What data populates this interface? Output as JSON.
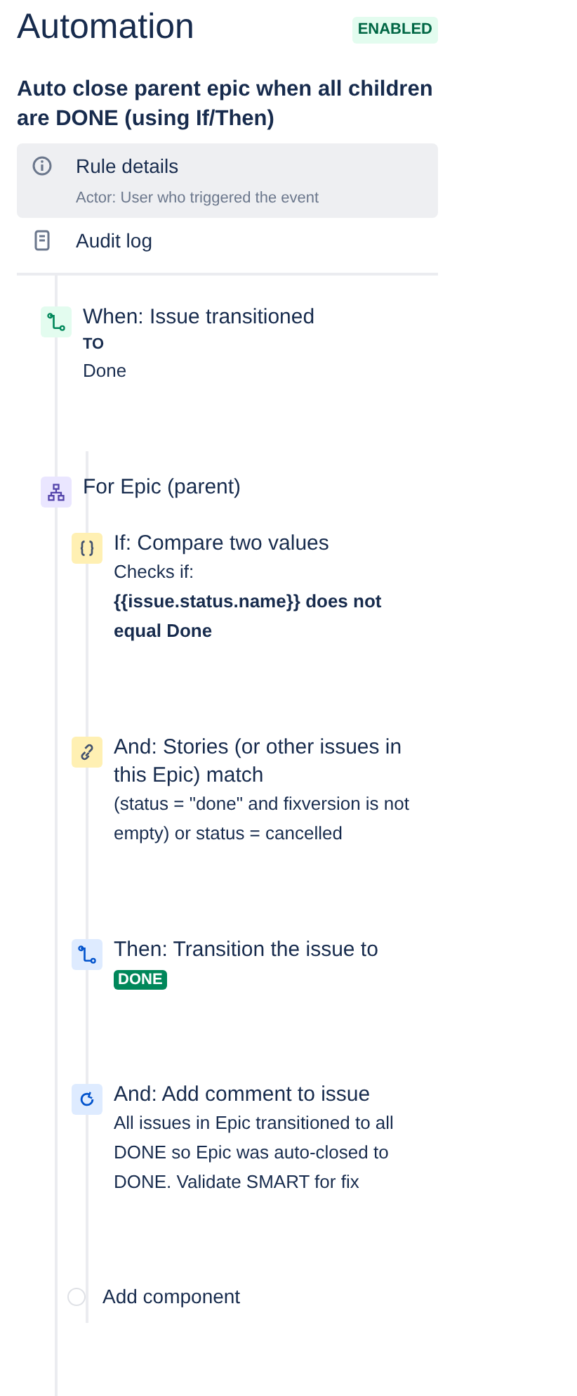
{
  "header": {
    "title": "Automation",
    "status": "ENABLED",
    "enabled": true
  },
  "rule_name": "Auto close parent epic when all children are DONE (using If/Then)",
  "menu": [
    {
      "label": "Rule details",
      "sublabel": "Actor: User who triggered the event",
      "selected": true
    },
    {
      "label": "Audit log",
      "selected": false
    }
  ],
  "flow": [
    {
      "kind": "trigger",
      "title": "When: Issue transitioned",
      "details": [
        {
          "kind": "label",
          "text": "TO"
        },
        {
          "kind": "text",
          "text": "Done"
        }
      ]
    },
    {
      "kind": "branch",
      "title": "For Epic (parent)",
      "children": [
        {
          "kind": "compare",
          "title": "If: Compare two values",
          "details": [
            {
              "kind": "text",
              "text": "Checks if:"
            },
            {
              "kind": "strong",
              "text": "{{issue.status.name}} does not equal Done"
            }
          ]
        },
        {
          "kind": "related",
          "title": "And: Stories (or other issues in this Epic) match",
          "details": [
            {
              "kind": "text",
              "text": "(status = \"done\" and fixversion is not empty) or status = cancelled"
            }
          ]
        },
        {
          "kind": "transition",
          "title": "Then: Transition the issue to",
          "details": [
            {
              "kind": "lozenge",
              "text": "DONE"
            }
          ]
        },
        {
          "kind": "comment",
          "title": "And: Add comment to issue",
          "details": [
            {
              "kind": "text",
              "text": "All issues in Epic transitioned to all DONE so Epic was auto-closed to DONE. Validate SMART for fix"
            }
          ]
        },
        {
          "kind": "add",
          "title": "Add component"
        }
      ]
    }
  ]
}
